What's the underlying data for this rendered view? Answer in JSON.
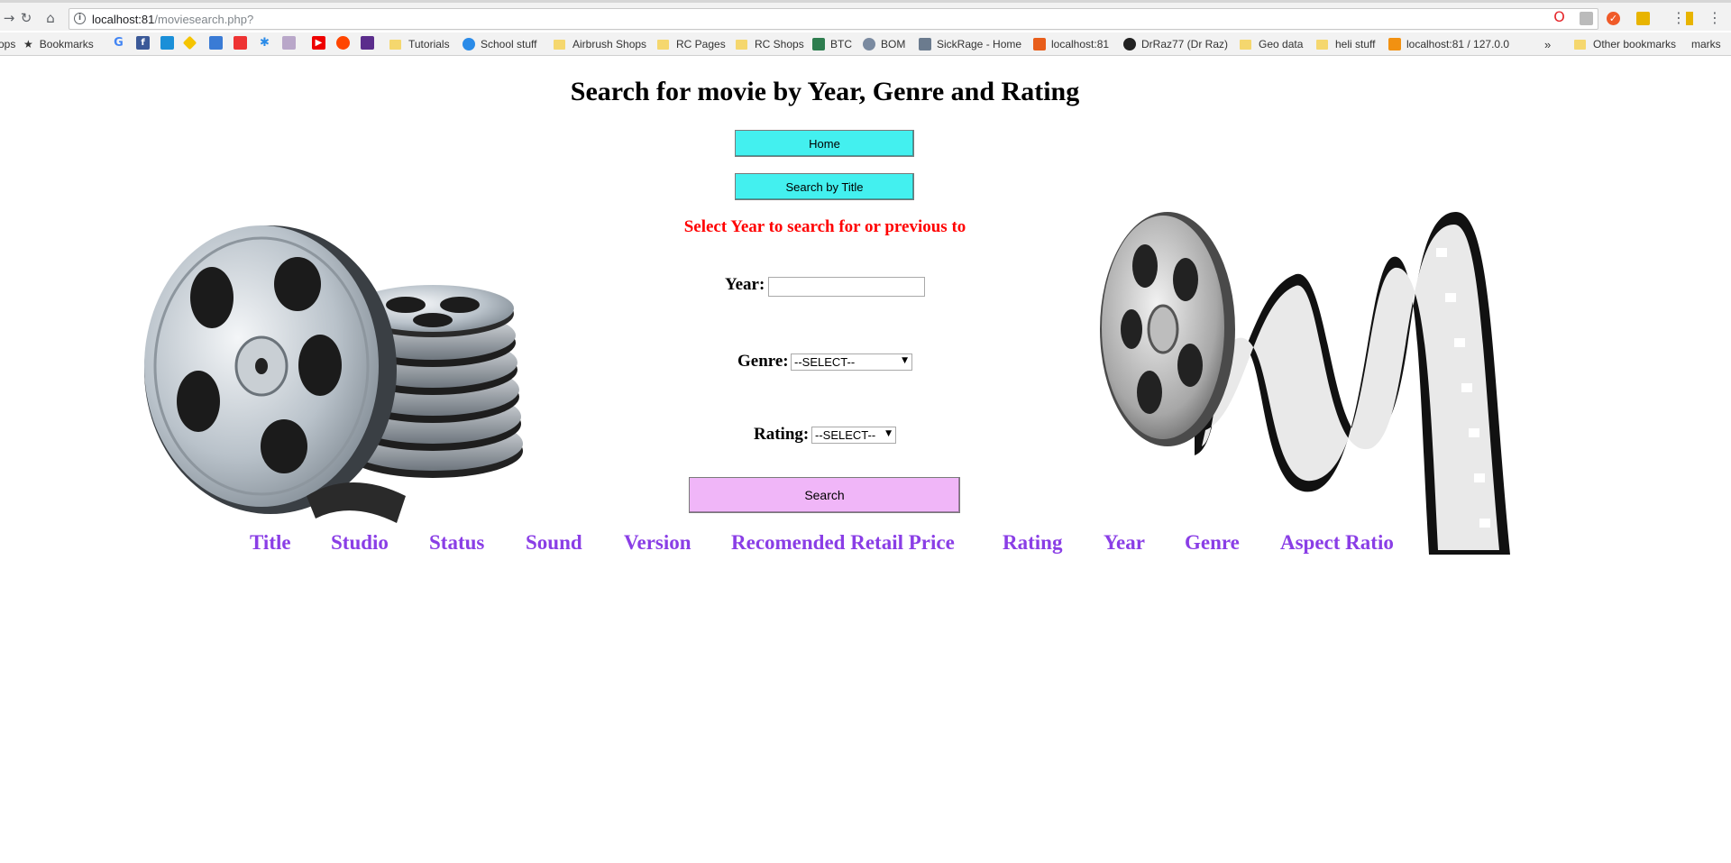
{
  "browser": {
    "url_host": "localhost:81",
    "url_path": "/moviesearch.php?",
    "bookmarks": [
      {
        "label": "ops"
      },
      {
        "label": "Bookmarks"
      },
      {
        "label": "Tutorials"
      },
      {
        "label": "School stuff"
      },
      {
        "label": "Airbrush Shops"
      },
      {
        "label": "RC Pages"
      },
      {
        "label": "RC Shops"
      },
      {
        "label": "BTC"
      },
      {
        "label": "BOM"
      },
      {
        "label": "SickRage - Home"
      },
      {
        "label": "localhost:81"
      },
      {
        "label": "DrRaz77 (Dr Raz)"
      },
      {
        "label": "Geo data"
      },
      {
        "label": "heli stuff"
      },
      {
        "label": "localhost:81 / 127.0.0"
      },
      {
        "label": "»"
      },
      {
        "label": "Other bookmarks"
      },
      {
        "label": "marks"
      }
    ]
  },
  "page": {
    "title": "Search for movie by Year, Genre and Rating",
    "home_button": "Home",
    "search_title_button": "Search by Title",
    "notice": "Select Year to search for or previous to",
    "year_label": "Year:",
    "year_value": "",
    "genre_label": "Genre:",
    "genre_selected": "--SELECT--",
    "rating_label": "Rating:",
    "rating_selected": "--SELECT--",
    "search_button": "Search",
    "columns": [
      "Title",
      "Studio",
      "Status",
      "Sound",
      "Version",
      "Recomended Retail Price",
      "Rating",
      "Year",
      "Genre",
      "Aspect Ratio"
    ]
  },
  "colors": {
    "cyan_button": "#43f0ef",
    "pink_button": "#f0b6f8",
    "notice": "#ff0000",
    "column_header": "#8a3ee6"
  }
}
